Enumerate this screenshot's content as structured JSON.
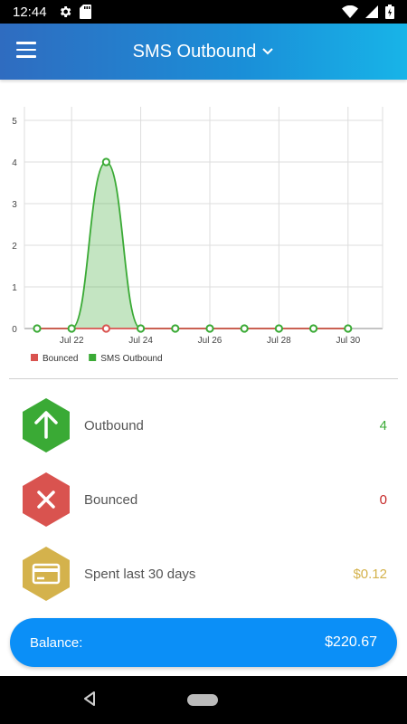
{
  "status_bar": {
    "time": "12:44"
  },
  "app_bar": {
    "title": "SMS Outbound"
  },
  "chart_data": {
    "type": "line",
    "x": [
      "Jul 21",
      "Jul 22",
      "Jul 23",
      "Jul 24",
      "Jul 25",
      "Jul 26",
      "Jul 27",
      "Jul 28",
      "Jul 29",
      "Jul 30"
    ],
    "tick_labels": [
      "Jul 22",
      "Jul 24",
      "Jul 26",
      "Jul 28",
      "Jul 30"
    ],
    "y_ticks": [
      "0",
      "1",
      "2",
      "3",
      "4",
      "5"
    ],
    "ylim": [
      0,
      5
    ],
    "grid": true,
    "legend_position": "bottom-left",
    "series": [
      {
        "name": "Bounced",
        "color": "#d9534f",
        "values": [
          0,
          0,
          0,
          0,
          0,
          0,
          0,
          0,
          0,
          0
        ]
      },
      {
        "name": "SMS Outbound",
        "color": "#3aaa35",
        "values": [
          0,
          0,
          4,
          0,
          0,
          0,
          0,
          0,
          0,
          0
        ]
      }
    ]
  },
  "stats": [
    {
      "label": "Outbound",
      "value": "4",
      "color": "#3aaa35",
      "icon": "arrow-up-icon"
    },
    {
      "label": "Bounced",
      "value": "0",
      "color": "#d9534f",
      "icon": "close-icon"
    },
    {
      "label": "Spent last 30 days",
      "value": "$0.12",
      "color": "#d4b24c",
      "icon": "credit-card-icon"
    }
  ],
  "balance": {
    "label": "Balance:",
    "value": "$220.67"
  }
}
